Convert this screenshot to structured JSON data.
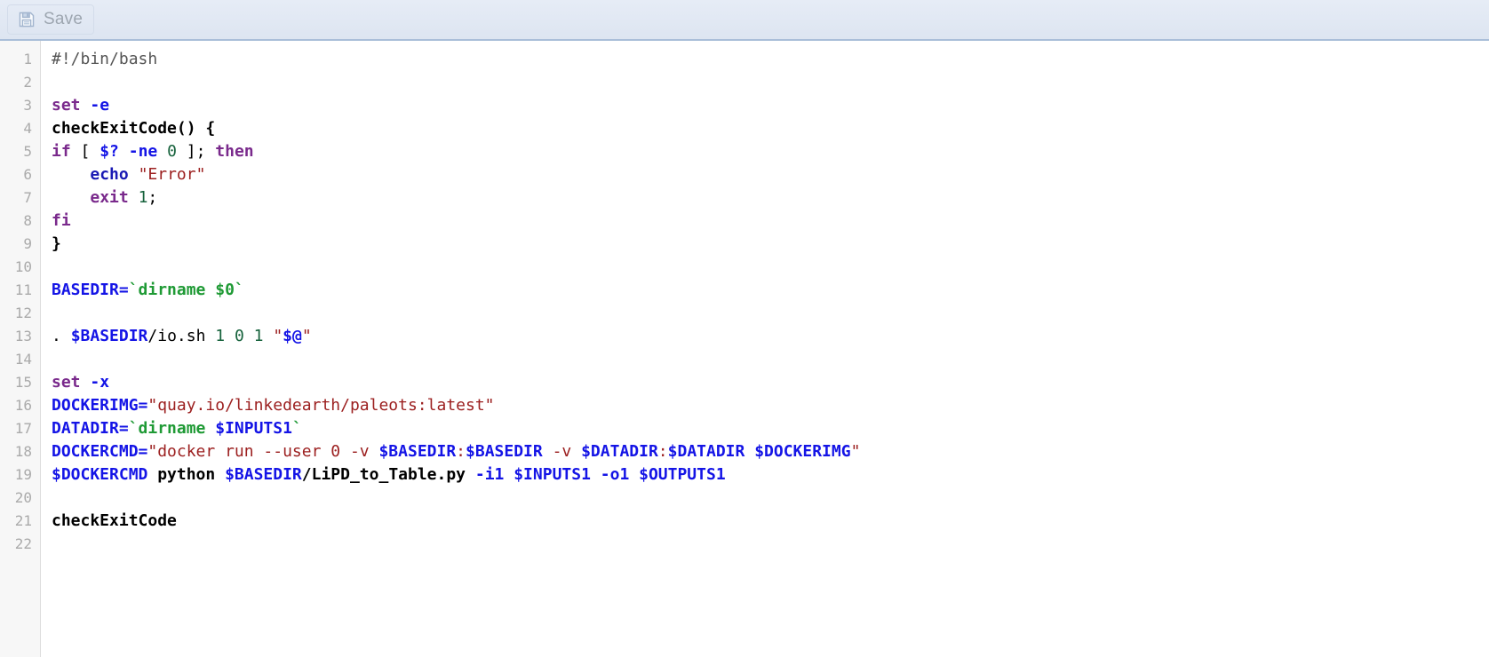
{
  "toolbar": {
    "save_label": "Save",
    "save_icon": "floppy-disk-save-icon",
    "disabled": true
  },
  "editor": {
    "language": "bash",
    "line_count": 22,
    "line_numbers": [
      1,
      2,
      3,
      4,
      5,
      6,
      7,
      8,
      9,
      10,
      11,
      12,
      13,
      14,
      15,
      16,
      17,
      18,
      19,
      20,
      21,
      22
    ],
    "plain_text": "#!/bin/bash\n\nset -e\ncheckExitCode() {\nif [ $? -ne 0 ]; then\n    echo \"Error\"\n    exit 1;\nfi\n}\n\nBASEDIR=`dirname $0`\n\n. $BASEDIR/io.sh 1 0 1 \"$@\"\n\nset -x\nDOCKERIMG=\"quay.io/linkedearth/paleots:latest\"\nDATADIR=`dirname $INPUTS1`\nDOCKERCMD=\"docker run --user 0 -v $BASEDIR:$BASEDIR -v $DATADIR:$DATADIR $DOCKERIMG\"\n$DOCKERCMD python $BASEDIR/LiPD_to_Table.py -i1 $INPUTS1 -o1 $OUTPUTS1\n\ncheckExitCode\n",
    "lines": [
      {
        "n": 1,
        "tokens": [
          {
            "t": "#!/bin/bash",
            "c": "t-comment"
          }
        ]
      },
      {
        "n": 2,
        "tokens": []
      },
      {
        "n": 3,
        "tokens": [
          {
            "t": "set",
            "c": "t-kw"
          },
          {
            "t": " ",
            "c": "t-plain"
          },
          {
            "t": "-e",
            "c": "t-opt"
          }
        ]
      },
      {
        "n": 4,
        "tokens": [
          {
            "t": "checkExitCode() {",
            "c": "t-fn"
          }
        ]
      },
      {
        "n": 5,
        "tokens": [
          {
            "t": "if",
            "c": "t-kw"
          },
          {
            "t": " [ ",
            "c": "t-plain"
          },
          {
            "t": "$?",
            "c": "t-var"
          },
          {
            "t": " ",
            "c": "t-plain"
          },
          {
            "t": "-ne",
            "c": "t-opt"
          },
          {
            "t": " ",
            "c": "t-plain"
          },
          {
            "t": "0",
            "c": "t-num"
          },
          {
            "t": " ]; ",
            "c": "t-plain"
          },
          {
            "t": "then",
            "c": "t-kw"
          }
        ]
      },
      {
        "n": 6,
        "tokens": [
          {
            "t": "    ",
            "c": "t-plain"
          },
          {
            "t": "echo",
            "c": "t-builtin"
          },
          {
            "t": " ",
            "c": "t-plain"
          },
          {
            "t": "\"Error\"",
            "c": "t-str"
          }
        ]
      },
      {
        "n": 7,
        "tokens": [
          {
            "t": "    ",
            "c": "t-plain"
          },
          {
            "t": "exit",
            "c": "t-kw"
          },
          {
            "t": " ",
            "c": "t-plain"
          },
          {
            "t": "1",
            "c": "t-num"
          },
          {
            "t": ";",
            "c": "t-plain"
          }
        ]
      },
      {
        "n": 8,
        "tokens": [
          {
            "t": "fi",
            "c": "t-kw"
          }
        ]
      },
      {
        "n": 9,
        "tokens": [
          {
            "t": "}",
            "c": "t-fn"
          }
        ]
      },
      {
        "n": 10,
        "tokens": []
      },
      {
        "n": 11,
        "tokens": [
          {
            "t": "BASEDIR=",
            "c": "t-var"
          },
          {
            "t": "`dirname $0`",
            "c": "t-backtick"
          }
        ]
      },
      {
        "n": 12,
        "tokens": []
      },
      {
        "n": 13,
        "tokens": [
          {
            "t": ". ",
            "c": "t-plain"
          },
          {
            "t": "$BASEDIR",
            "c": "t-var"
          },
          {
            "t": "/io.sh ",
            "c": "t-plain"
          },
          {
            "t": "1",
            "c": "t-num"
          },
          {
            "t": " ",
            "c": "t-plain"
          },
          {
            "t": "0",
            "c": "t-num"
          },
          {
            "t": " ",
            "c": "t-plain"
          },
          {
            "t": "1",
            "c": "t-num"
          },
          {
            "t": " ",
            "c": "t-plain"
          },
          {
            "t": "\"",
            "c": "t-str"
          },
          {
            "t": "$@",
            "c": "t-var"
          },
          {
            "t": "\"",
            "c": "t-str"
          }
        ]
      },
      {
        "n": 14,
        "tokens": []
      },
      {
        "n": 15,
        "tokens": [
          {
            "t": "set",
            "c": "t-kw"
          },
          {
            "t": " ",
            "c": "t-plain"
          },
          {
            "t": "-x",
            "c": "t-opt"
          }
        ]
      },
      {
        "n": 16,
        "tokens": [
          {
            "t": "DOCKERIMG=",
            "c": "t-var"
          },
          {
            "t": "\"quay.io/linkedearth/paleots:latest\"",
            "c": "t-str"
          }
        ]
      },
      {
        "n": 17,
        "tokens": [
          {
            "t": "DATADIR=",
            "c": "t-var"
          },
          {
            "t": "`dirname ",
            "c": "t-backtick"
          },
          {
            "t": "$INPUTS1",
            "c": "t-var"
          },
          {
            "t": "`",
            "c": "t-backtick"
          }
        ]
      },
      {
        "n": 18,
        "tokens": [
          {
            "t": "DOCKERCMD=",
            "c": "t-var"
          },
          {
            "t": "\"docker run --user 0 -v ",
            "c": "t-str"
          },
          {
            "t": "$BASEDIR",
            "c": "t-var"
          },
          {
            "t": ":",
            "c": "t-str"
          },
          {
            "t": "$BASEDIR",
            "c": "t-var"
          },
          {
            "t": " ",
            "c": "t-str"
          },
          {
            "t": "-v",
            "c": "t-str"
          },
          {
            "t": " ",
            "c": "t-str"
          },
          {
            "t": "$DATADIR",
            "c": "t-var"
          },
          {
            "t": ":",
            "c": "t-str"
          },
          {
            "t": "$DATADIR",
            "c": "t-var"
          },
          {
            "t": " ",
            "c": "t-str"
          },
          {
            "t": "$DOCKERIMG",
            "c": "t-var"
          },
          {
            "t": "\"",
            "c": "t-str"
          }
        ]
      },
      {
        "n": 19,
        "tokens": [
          {
            "t": "$DOCKERCMD",
            "c": "t-var"
          },
          {
            "t": " python ",
            "c": "t-bold"
          },
          {
            "t": "$BASEDIR",
            "c": "t-var"
          },
          {
            "t": "/LiPD_to_Table.py ",
            "c": "t-bold"
          },
          {
            "t": "-i1",
            "c": "t-opt"
          },
          {
            "t": " ",
            "c": "t-plain"
          },
          {
            "t": "$INPUTS1",
            "c": "t-var"
          },
          {
            "t": " ",
            "c": "t-plain"
          },
          {
            "t": "-o1",
            "c": "t-opt"
          },
          {
            "t": " ",
            "c": "t-plain"
          },
          {
            "t": "$OUTPUTS1",
            "c": "t-var"
          }
        ]
      },
      {
        "n": 20,
        "tokens": []
      },
      {
        "n": 21,
        "tokens": [
          {
            "t": "checkExitCode",
            "c": "t-fn"
          }
        ]
      },
      {
        "n": 22,
        "tokens": []
      }
    ]
  },
  "colors": {
    "toolbar_top": "#e6ecf6",
    "toolbar_bottom": "#dde5f1",
    "toolbar_border": "#a9bed9",
    "gutter_bg": "#f7f7f7",
    "gutter_text": "#aaaaaa",
    "editor_bg": "#ffffff",
    "keyword": "#7a2a8c",
    "builtin": "#1a1ab4",
    "variable": "#1414e6",
    "string": "#9c2020",
    "number": "#16623c",
    "backtick": "#1f9a35",
    "comment": "#555555",
    "save_label": "#9aa3ad"
  }
}
